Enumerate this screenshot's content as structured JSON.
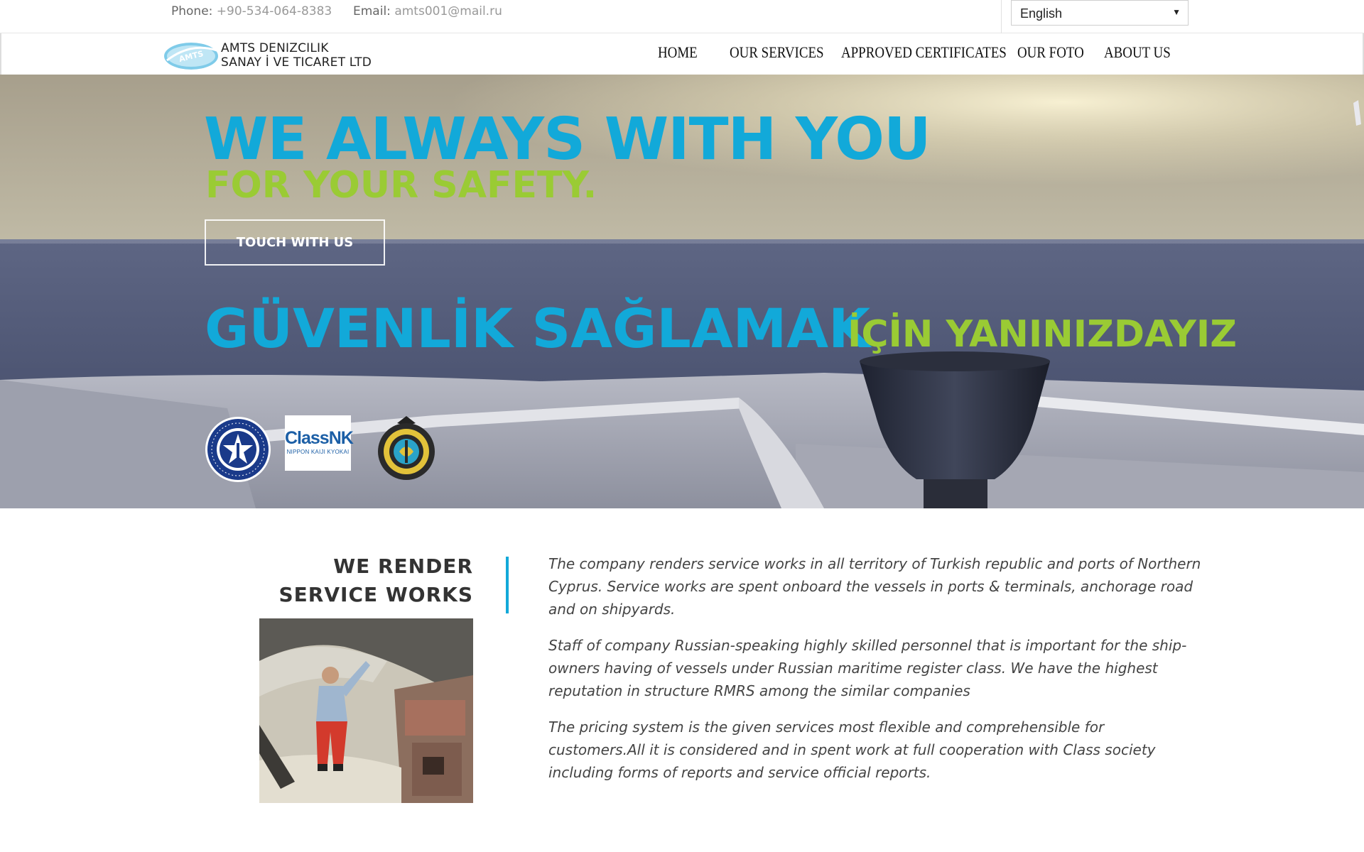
{
  "topbar": {
    "phone_label": "Phone:",
    "phone_value": "+90-534-064-8383",
    "email_label": "Email:",
    "email_value": "amts001@mail.ru",
    "language_selected": "English"
  },
  "logo": {
    "emblem_text": "AMTS",
    "line1": "AMTS DENIZCILIK",
    "line2": "SANAY İ VE TICARET LTD"
  },
  "nav": {
    "items": [
      {
        "label": "HOME"
      },
      {
        "label": "OUR SERVICES"
      },
      {
        "label": "APPROVED CERTIFICATES"
      },
      {
        "label": "OUR FOTO"
      },
      {
        "label": "ABOUT US"
      }
    ]
  },
  "hero": {
    "headline": "WE ALWAYS WITH YOU",
    "subheadline": "FOR YOUR SAFETY.",
    "button_label": "TOUCH WITH US",
    "turkish_part1": "GÜVENLİK SAĞLAMAK",
    "turkish_part2": "İÇİN YANINIZDAYIZ",
    "certificates": {
      "classnk_title": "ClassNK",
      "classnk_subtitle": "NIPPON KAIJI KYOKAI"
    }
  },
  "content": {
    "title_line1": "WE RENDER",
    "title_line2": "SERVICE WORKS",
    "paragraphs": [
      "The company renders service works in all territory of Turkish republic and ports of Northern Cyprus. Service works are spent onboard the vessels in ports & terminals, anchorage road and on shipyards.",
      "Staff of company Russian-speaking highly skilled personnel that is important for the ship-owners having of vessels under Russian maritime register class. We have the highest reputation in structure RMRS among the similar companies",
      "The pricing system is the given services most flexible and comprehensible for customers.All it is considered and in spent work at full cooperation with Class society including forms of reports and service official reports."
    ]
  },
  "colors": {
    "accent_blue": "#12a9d9",
    "accent_green": "#9acb34",
    "text_dark": "#333333"
  },
  "icons": [
    "rmrs-emblem-icon",
    "classnk-logo-icon",
    "shipping-register-emblem-icon",
    "dropdown-caret-icon"
  ]
}
